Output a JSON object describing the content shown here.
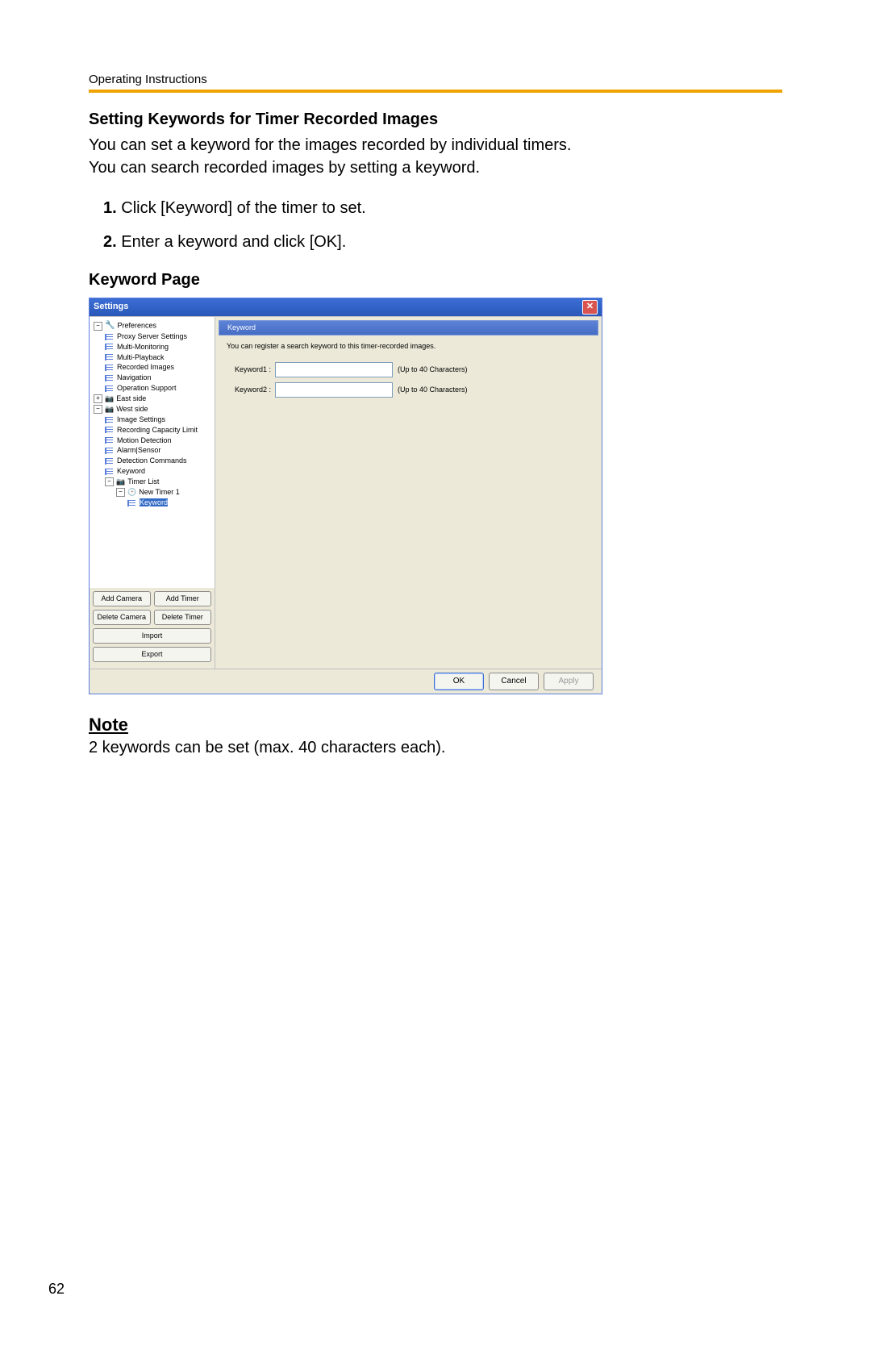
{
  "doc": {
    "header": "Operating Instructions",
    "section_title": "Setting Keywords for Timer Recorded Images",
    "intro_line1": "You can set a keyword for the images recorded by individual timers.",
    "intro_line2": "You can search recorded images by setting a keyword.",
    "step1_num": "1.",
    "step1_text": "Click [Keyword] of the timer to set.",
    "step2_num": "2.",
    "step2_text": "Enter a keyword and click [OK].",
    "sub_title": "Keyword Page",
    "note_label": "Note",
    "note_text": "2 keywords can be set (max. 40 characters each).",
    "page_number": "62"
  },
  "win": {
    "title": "Settings",
    "close_glyph": "✕",
    "tree": {
      "preferences": "Preferences",
      "proxy": "Proxy Server Settings",
      "multimon": "Multi-Monitoring",
      "multiplay": "Multi-Playback",
      "recimg": "Recorded Images",
      "nav": "Navigation",
      "opsupport": "Operation Support",
      "east": "East side",
      "west": "West side",
      "imgset": "Image Settings",
      "reccap": "Recording Capacity Limit",
      "motion": "Motion Detection",
      "alarm": "Alarm|Sensor",
      "detcmd": "Detection Commands",
      "keyword_node": "Keyword",
      "timerlist": "Timer List",
      "newtimer": "New Timer 1",
      "keyword_sel": "Keyword"
    },
    "sidebar_btn": {
      "add_camera": "Add Camera",
      "add_timer": "Add Timer",
      "del_camera": "Delete Camera",
      "del_timer": "Delete Timer",
      "import": "Import",
      "export": "Export"
    },
    "panel": {
      "title": "Keyword",
      "desc": "You can register a search keyword to this timer-recorded images.",
      "k1_label": "Keyword1 :",
      "k2_label": "Keyword2 :",
      "hint": "(Up to 40 Characters)"
    },
    "footer": {
      "ok": "OK",
      "cancel": "Cancel",
      "apply": "Apply"
    }
  }
}
